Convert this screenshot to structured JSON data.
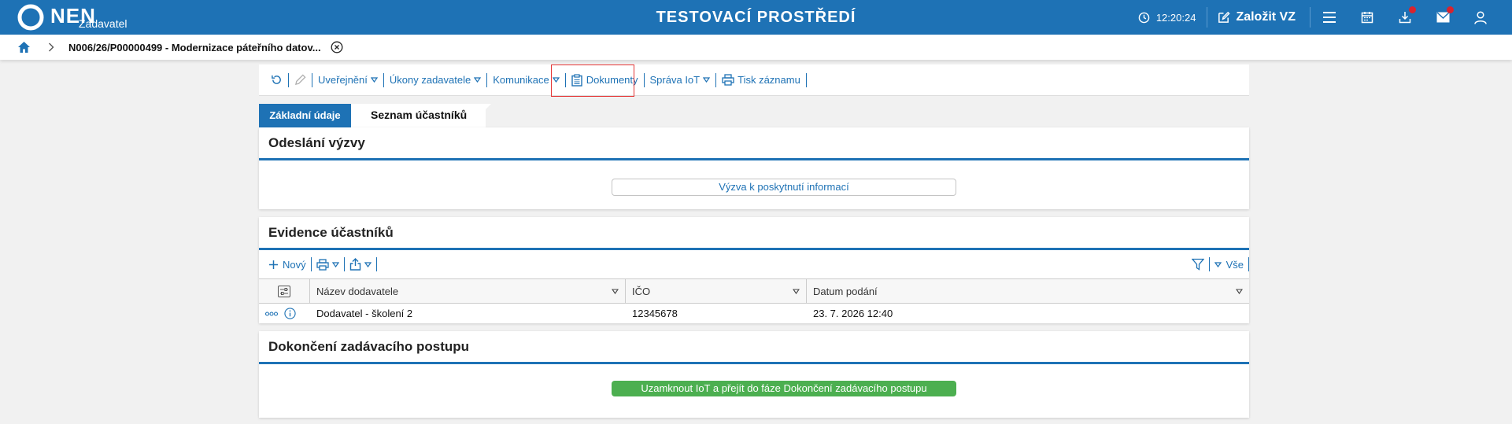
{
  "header": {
    "logo_text": "NEN",
    "logo_sub": "Zadavatel",
    "environment": "TESTOVACÍ PROSTŘEDÍ",
    "clock": "12:20:24",
    "create_label": "Založit VZ"
  },
  "breadcrumb": {
    "current": "N006/26/P00000499 - Modernizace páteřního datov..."
  },
  "toolbar": {
    "publish": "Uveřejnění",
    "actions": "Úkony zadavatele",
    "communication": "Komunikace",
    "documents": "Dokumenty",
    "iot": "Správa IoT",
    "print": "Tisk záznamu"
  },
  "tabs": {
    "basic": "Základní údaje",
    "participants": "Seznam účastníků"
  },
  "section_invite": {
    "title": "Odeslání výzvy",
    "button": "Výzva k poskytnutí informací"
  },
  "section_evidence": {
    "title": "Evidence účastníků",
    "new_label": "Nový",
    "filter_all": "Vše",
    "columns": [
      "Název dodavatele",
      "IČO",
      "Datum podání"
    ],
    "rows": [
      {
        "name": "Dodavatel - školení 2",
        "ico": "12345678",
        "date": "23. 7. 2026 12:40"
      }
    ]
  },
  "section_finish": {
    "title": "Dokončení zadávacího postupu",
    "button": "Uzamknout IoT a přejít do fáze Dokončení zadávacího postupu"
  },
  "colors": {
    "brand": "#1e72b5",
    "success": "#4caf50",
    "alert": "#d9232e"
  }
}
